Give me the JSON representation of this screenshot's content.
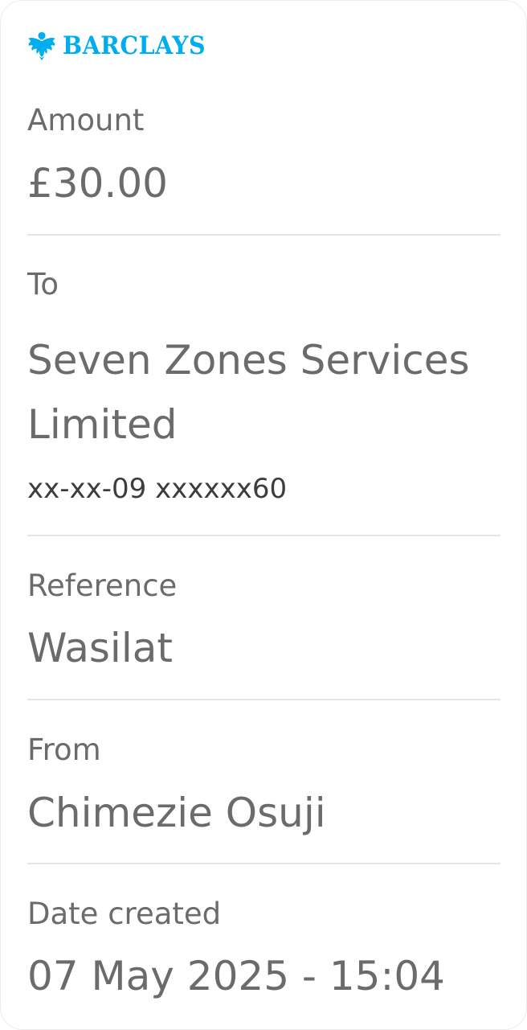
{
  "brand": {
    "name": "BARCLAYS",
    "icon": "eagle-icon",
    "color": "#00aeef"
  },
  "amount": {
    "label": "Amount",
    "value": "£30.00"
  },
  "to": {
    "label": "To",
    "name": "Seven Zones Services Limited",
    "account": "xx-xx-09 xxxxxx60"
  },
  "reference": {
    "label": "Reference",
    "value": "Wasilat"
  },
  "from": {
    "label": "From",
    "value": "Chimezie Osuji"
  },
  "date_created": {
    "label": "Date created",
    "value": "07 May 2025 - 15:04"
  }
}
